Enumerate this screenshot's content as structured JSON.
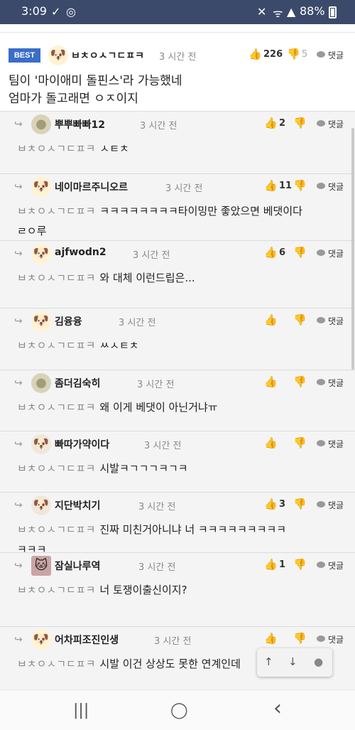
{
  "status": {
    "time": "3:09",
    "battery": "88%"
  },
  "best": {
    "badge": "BEST",
    "nick": "ㅂㅊㅇㅅㄱㄷㅍㅋ",
    "time": "3 시간 전",
    "likes": "226",
    "dislikes": "5",
    "reply_label": "댓글",
    "line1": "팀이 '마이애미 돌핀스'라 가능했네",
    "line2": "엄마가 돌고래면 ㅇㅈ이지"
  },
  "comments": [
    {
      "nick": "뿌뿌빠빠12",
      "time": "3 시간 전",
      "likes": "2",
      "author": "ㅂㅊㅇㅅㄱㄷㅍㅋ",
      "text": "ㅅㅌㅊ",
      "reply": "댓글"
    },
    {
      "nick": "네이마르주니오르",
      "time": "3 시간 전",
      "likes": "11",
      "author": "ㅂㅊㅇㅅㄱㄷㅍㅋ",
      "text": "ㅋㅋㅋㅋㅋㅋㅋㅋ타이밍만 좋았으면 베댓이다",
      "text2": "ㄹㅇ루",
      "reply": "댓글"
    },
    {
      "nick": "ajfwodn2",
      "time": "3 시간 전",
      "likes": "6",
      "author": "ㅂㅊㅇㅅㄱㄷㅍㅋ",
      "text": "와 대체 이런드립은...",
      "reply": "댓글"
    },
    {
      "nick": "김융융",
      "time": "3 시간 전",
      "likes": "",
      "author": "ㅂㅊㅇㅅㄱㄷㅍㅋ",
      "text": "ㅆㅅㅌㅊ",
      "reply": "댓글"
    },
    {
      "nick": "좀더김숙히",
      "time": "3 시간 전",
      "likes": "",
      "author": "ㅂㅊㅇㅅㄱㄷㅍㅋ",
      "text": "왜 이게 베댓이 아닌거냐ㅠ",
      "reply": "댓글"
    },
    {
      "nick": "빠따가약이다",
      "time": "3 시간 전",
      "likes": "",
      "author": "ㅂㅊㅇㅅㄱㄷㅍㅋ",
      "text": "시발ㅋㄱㄱㄱㅋㄱㅋ",
      "reply": "댓글"
    },
    {
      "nick": "지단박치기",
      "time": "3 시간 전",
      "likes": "3",
      "author": "ㅂㅊㅇㅅㄱㄷㅍㅋ",
      "text": "진짜 미친거아니냐 너 ㅋㅋㅋㅋㅋㅋㅋㅋㅋ",
      "text2": "ㅋㅋㅋ",
      "reply": "댓글"
    },
    {
      "nick": "잠실나루역",
      "time": "3 시간 전",
      "likes": "1",
      "author": "ㅂㅊㅇㅅㄱㄷㅍㅋ",
      "text": "너 토쟁이출신이지?",
      "reply": "댓글"
    },
    {
      "nick": "어차피조진인생",
      "time": "3 시간 전",
      "likes": "",
      "author": "ㅂㅊㅇㅅㄱㄷㅍㅋ",
      "text": "시발 이건 상상도 못한 연계인데",
      "reply": "댓글"
    }
  ],
  "icons": {
    "check": "✓",
    "globe": "◎",
    "mute": "✕",
    "wifi": "ᯤ",
    "signal": "▲",
    "reply_arrow": "↪",
    "like": "👍",
    "dislike": "👎",
    "up": "↑",
    "down": "↓",
    "chat": "●",
    "nav_recent": "|||",
    "nav_home": "◯",
    "nav_back": "‹"
  },
  "colors": {
    "status_bar": "#3b4a6b",
    "best_badge": "#3a6ec9",
    "reply_bg": "#f4f4f4"
  }
}
